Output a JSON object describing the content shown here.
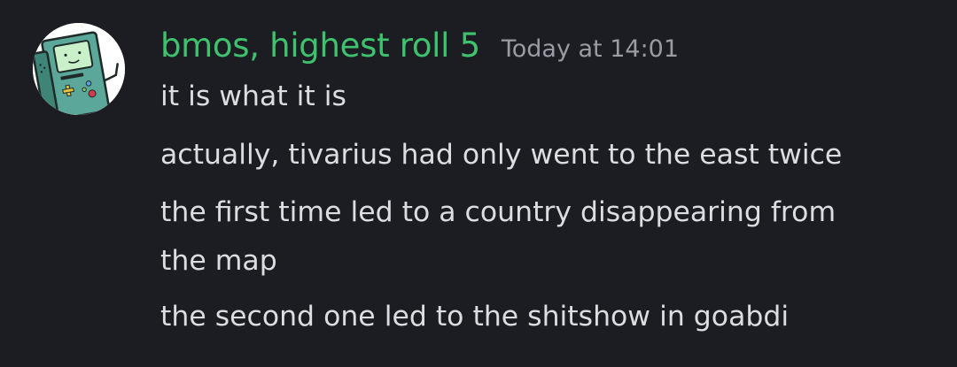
{
  "message": {
    "author": {
      "name": "bmos, highest roll 5",
      "name_color": "#3fc26e",
      "avatar": "bmo-avatar-icon"
    },
    "timestamp": "Today at 14:01",
    "lines": [
      "it is what it is",
      "actually, tivarius had only went to the east twice",
      "the first time led to a country disappearing from",
      "the map",
      "the second one led to the shitshow in goabdi"
    ]
  },
  "colors": {
    "background": "#1c1d23",
    "text": "#dbdee1",
    "timestamp": "#9a9ca3"
  }
}
